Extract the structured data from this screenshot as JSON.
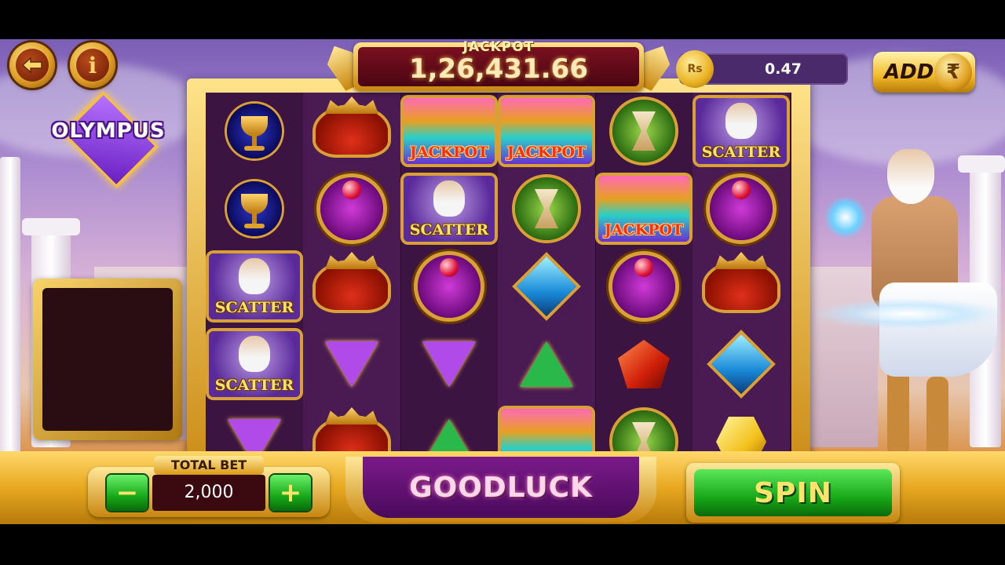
{
  "header": {
    "back_icon": "arrow-left-icon",
    "info_icon": "info-icon",
    "info_glyph": "i",
    "game_logo": "OLYMPUS"
  },
  "jackpot": {
    "label": "JACKPOT",
    "value": "1,26,431.66"
  },
  "balance": {
    "coin_label": "Rs",
    "value": "0.47"
  },
  "add_button": {
    "label": "ADD",
    "icon": "rupee-icon",
    "glyph": "₹"
  },
  "reels": [
    [
      "goblet",
      "goblet",
      "scatter",
      "scatter",
      "gem-purple"
    ],
    [
      "crown",
      "ring",
      "crown",
      "gem-purple",
      "crown"
    ],
    [
      "jackpot",
      "scatter",
      "ring",
      "gem-purple",
      "gem-green"
    ],
    [
      "jackpot",
      "hourglass",
      "gem-blue",
      "gem-green",
      "jackpot"
    ],
    [
      "hourglass",
      "jackpot",
      "ring",
      "gem-red",
      "hourglass"
    ],
    [
      "scatter",
      "ring",
      "crown",
      "gem-blue",
      "gem-yellow"
    ]
  ],
  "symbol_labels": {
    "jackpot": "JACKPOT",
    "scatter": "SCATTER"
  },
  "bet": {
    "label": "TOTAL BET",
    "value": "2,000",
    "minus": "−",
    "plus": "+"
  },
  "status": {
    "message": "GOODLUCK"
  },
  "spin": {
    "label": "SPIN"
  },
  "colors": {
    "gold": "#e0a020",
    "reel_bg": "#3c1442",
    "green_button": "#18a818",
    "jackpot_bg": "#7a1020"
  }
}
